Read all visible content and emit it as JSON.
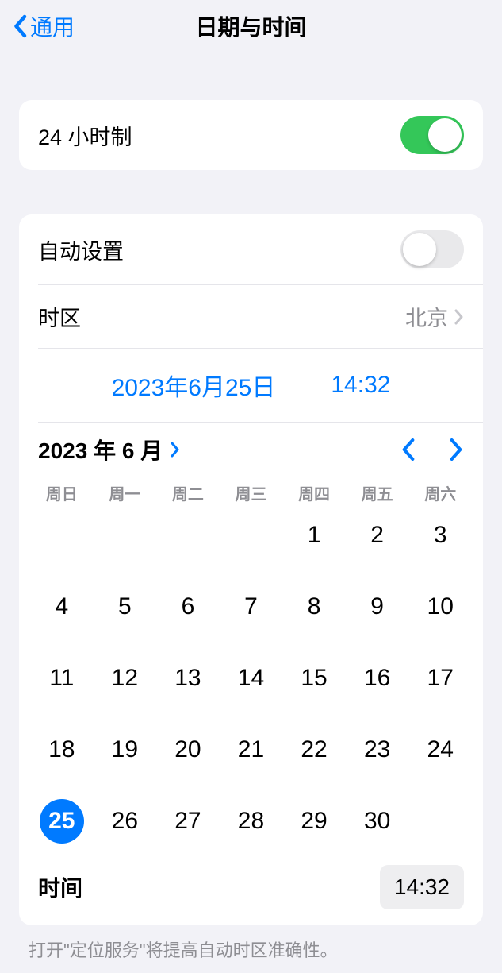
{
  "header": {
    "back_label": "通用",
    "title": "日期与时间"
  },
  "toggles": {
    "clock24_label": "24 小时制",
    "autoset_label": "自动设置"
  },
  "timezone": {
    "label": "时区",
    "value": "北京"
  },
  "datetime": {
    "date_display": "2023年6月25日",
    "time_display": "14:32"
  },
  "calendar": {
    "month_label": "2023 年 6 月",
    "weekdays": [
      "周日",
      "周一",
      "周二",
      "周三",
      "周四",
      "周五",
      "周六"
    ],
    "leading_blanks": 4,
    "days_in_month": 30,
    "selected_day": 25
  },
  "time_row": {
    "label": "时间",
    "value": "14:32"
  },
  "footer": "打开\"定位服务\"将提高自动时区准确性。"
}
